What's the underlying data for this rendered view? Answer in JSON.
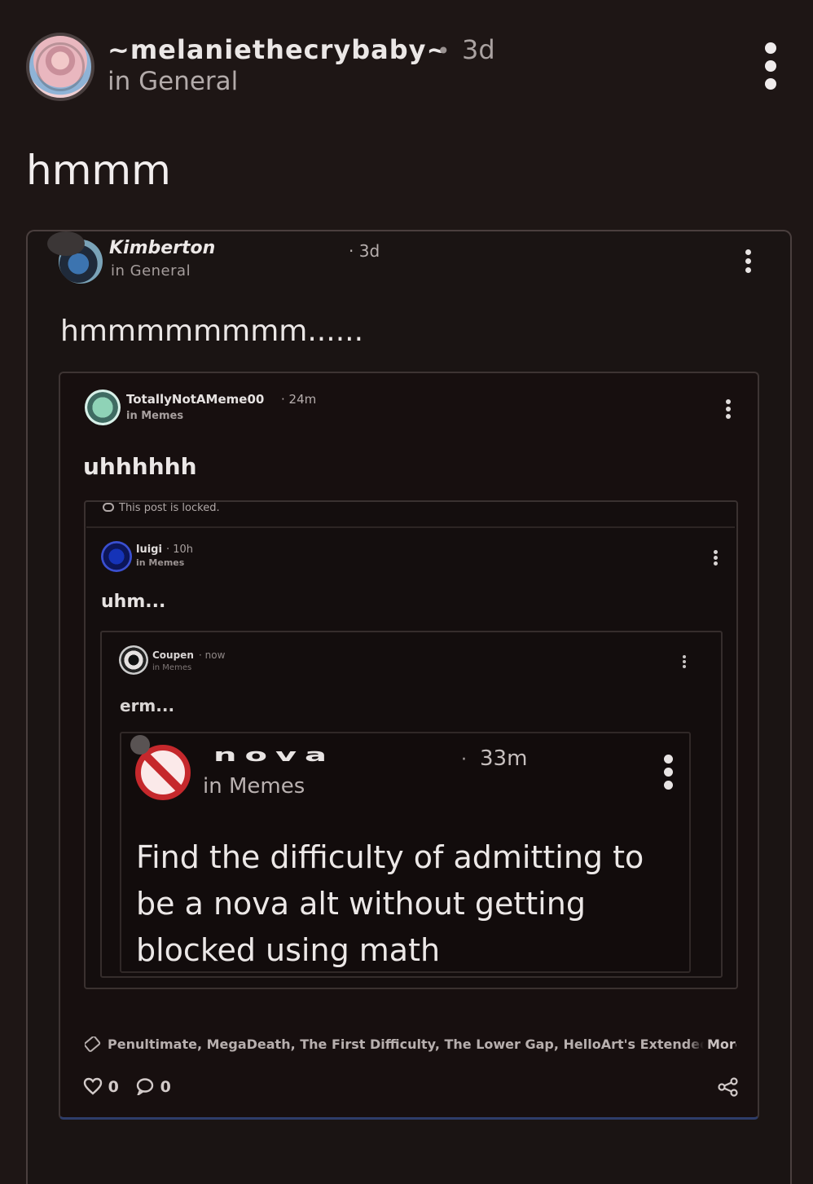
{
  "post": {
    "username": "~melaniethecrybaby~",
    "separator": "•",
    "time": "3d",
    "community": "in General",
    "body": "hmmm"
  },
  "screenshot": {
    "kimberton": {
      "username": "Kimberton",
      "community": "in General",
      "time": "· 3d",
      "body": "hmmmmmmmm......"
    },
    "totally": {
      "username": "TotallyNotAMeme00",
      "time": "· 24m",
      "community": "in Memes",
      "body": "uhhhhhh",
      "locked_notice": "This post is locked.",
      "tags": "Penultimate, MegaDeath, The First Difficulty, The Lower Gap, HelloArt's Extended Difficu",
      "more": "More",
      "likes": "0",
      "comments": "0"
    },
    "luigi": {
      "username": "luigi",
      "time": "· 10h",
      "community": "in Memes",
      "body": "uhm..."
    },
    "coupen": {
      "username": "Coupen",
      "time": "· now",
      "community": "in Memes",
      "body": "erm..."
    },
    "nova": {
      "username": "nova",
      "time": "33m",
      "separator": "·",
      "community": "in Memes",
      "body": "Find the difficulty of admitting to be a nova alt without getting blocked using math"
    }
  },
  "icons": {
    "kebab": "kebab-menu-icon",
    "heart": "heart-icon",
    "comment": "comment-icon",
    "share": "share-icon",
    "tag": "tag-icon",
    "lock": "lock-icon",
    "no_symbol": "no-symbol-icon"
  },
  "colors": {
    "background": "#1e1615",
    "no_symbol_red": "#c5282c",
    "accent_line": "#2e3d6a"
  }
}
